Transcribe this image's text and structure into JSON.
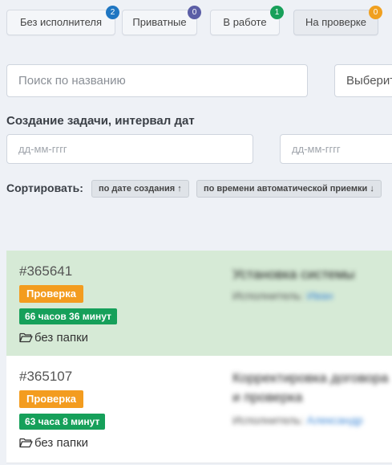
{
  "tabs": [
    {
      "label": "Без исполнителя",
      "count": "2",
      "badge_color": "#1f76c2",
      "active": false
    },
    {
      "label": "Приватные",
      "count": "0",
      "badge_color": "#5b5ea6",
      "active": false
    },
    {
      "label": "В работе",
      "count": "1",
      "badge_color": "#18a05a",
      "active": false
    },
    {
      "label": "На проверке",
      "count": "0",
      "badge_color": "#f0a020",
      "active": true
    }
  ],
  "filters": {
    "search_placeholder": "Поиск по названию",
    "select_value": "Выберит",
    "date_section_label": "Создание задачи, интервал дат",
    "date_from_placeholder": "дд-мм-гггг",
    "date_to_placeholder": "дд-мм-гггг"
  },
  "sort": {
    "label": "Сортировать:",
    "by_created": "по дате создания ↑",
    "by_auto_accept": "по времени автоматической приемки ↓"
  },
  "tasks": [
    {
      "id": "#365641",
      "status": "Проверка",
      "timer": "66 часов 36 минут",
      "folder": "без папки",
      "title_blurred": "Установка системы",
      "assignee_prefix": "Исполнитель:",
      "assignee_blurred": "Иван"
    },
    {
      "id": "#365107",
      "status": "Проверка",
      "timer": "63 часа 8 минут",
      "folder": "без папки",
      "title_blurred": "Корректировка договора",
      "title_blurred_2": "и проверка",
      "assignee_prefix": "Исполнитель:",
      "assignee_blurred": "Александр"
    }
  ],
  "colors": {
    "status_badge": "#f39c1f",
    "timer_badge": "#16a05a",
    "highlight_row": "#d6ead6",
    "page_bg": "#eef1f6"
  },
  "icons": {
    "folder": "folder-open-icon"
  }
}
